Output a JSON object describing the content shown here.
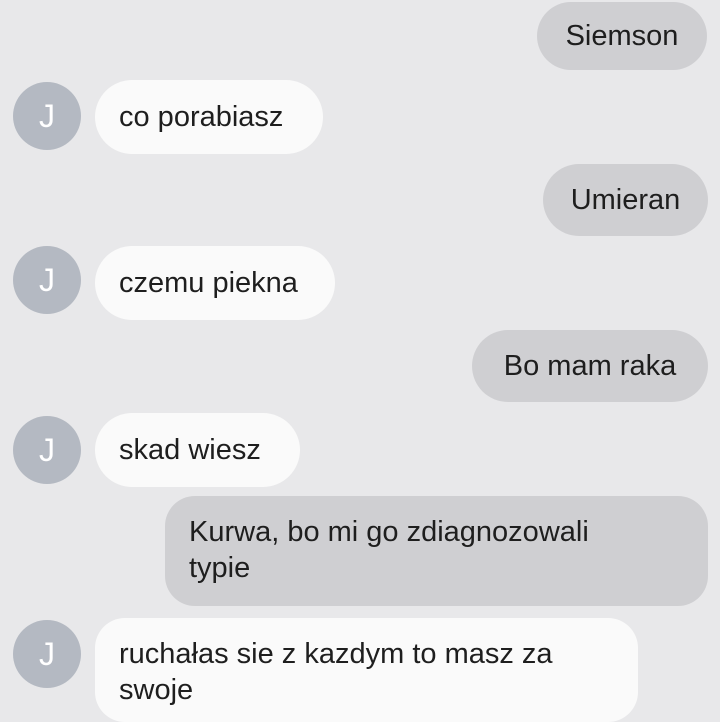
{
  "messages": [
    {
      "direction": "outgoing",
      "text": "Siemson"
    },
    {
      "direction": "incoming",
      "avatar": "J",
      "text": "co porabiasz"
    },
    {
      "direction": "outgoing",
      "text": "Umieran"
    },
    {
      "direction": "incoming",
      "avatar": "J",
      "text": "czemu piekna"
    },
    {
      "direction": "outgoing",
      "text": "Bo mam raka"
    },
    {
      "direction": "incoming",
      "avatar": "J",
      "text": "skad wiesz"
    },
    {
      "direction": "outgoing",
      "text": "Kurwa, bo mi go zdiagnozowali typie"
    },
    {
      "direction": "incoming",
      "avatar": "J",
      "text": "ruchałas sie  z kazdym to masz za swoje"
    }
  ],
  "colors": {
    "background": "#e8e8ea",
    "outgoing_bubble": "#cfcfd2",
    "incoming_bubble": "#fafafa",
    "avatar": "#b4b9c2"
  }
}
